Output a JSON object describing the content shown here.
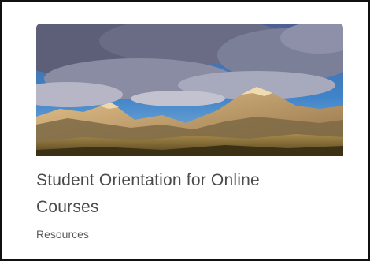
{
  "card": {
    "title": "Student Orientation for Online Courses",
    "category": "Resources",
    "image_subject": "mountain-landscape-image"
  },
  "colors": {
    "border": "#111111",
    "title_text": "#4a4a4a",
    "subtitle_text": "#5a5a5a",
    "sky": "#3a7bc8",
    "clouds": "#6b6e8a",
    "mountains": "#b98f5c"
  }
}
